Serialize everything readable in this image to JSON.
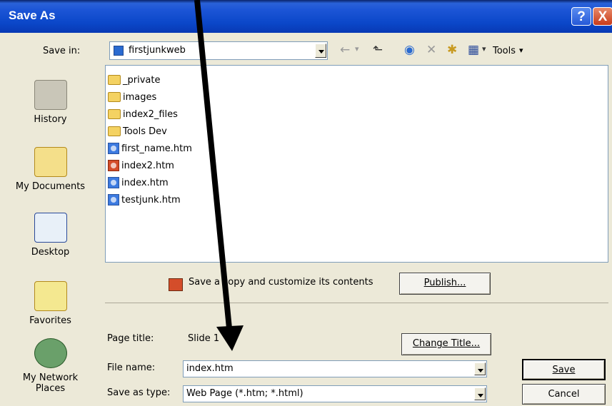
{
  "window": {
    "title": "Save As",
    "help_glyph": "?",
    "close_glyph": "X"
  },
  "save_in": {
    "label": "Save in:",
    "value": "firstjunkweb"
  },
  "toolbar": {
    "tools_label": "Tools"
  },
  "places": [
    {
      "label": "History",
      "icon": "history-icon"
    },
    {
      "label": "My Documents",
      "icon": "my-documents-icon"
    },
    {
      "label": "Desktop",
      "icon": "desktop-icon"
    },
    {
      "label": "Favorites",
      "icon": "favorites-icon"
    },
    {
      "label": "My Network Places",
      "icon": "network-places-icon"
    }
  ],
  "files": [
    {
      "name": "_private",
      "type": "folder"
    },
    {
      "name": "images",
      "type": "folder"
    },
    {
      "name": "index2_files",
      "type": "folder"
    },
    {
      "name": "Tools Dev",
      "type": "folder"
    },
    {
      "name": "first_name.htm",
      "type": "htm"
    },
    {
      "name": "index2.htm",
      "type": "htm"
    },
    {
      "name": "index.htm",
      "type": "htm"
    },
    {
      "name": "testjunk.htm",
      "type": "htm"
    }
  ],
  "publish": {
    "text": "Save a copy and customize its contents",
    "button": "Publish..."
  },
  "page_title": {
    "label": "Page title:",
    "value": "Slide 1",
    "button": "Change Title..."
  },
  "file_name": {
    "label": "File name:",
    "value": "index.htm"
  },
  "save_as_type": {
    "label": "Save as type:",
    "value": "Web Page (*.htm; *.html)"
  },
  "actions": {
    "save": "Save",
    "cancel": "Cancel"
  }
}
